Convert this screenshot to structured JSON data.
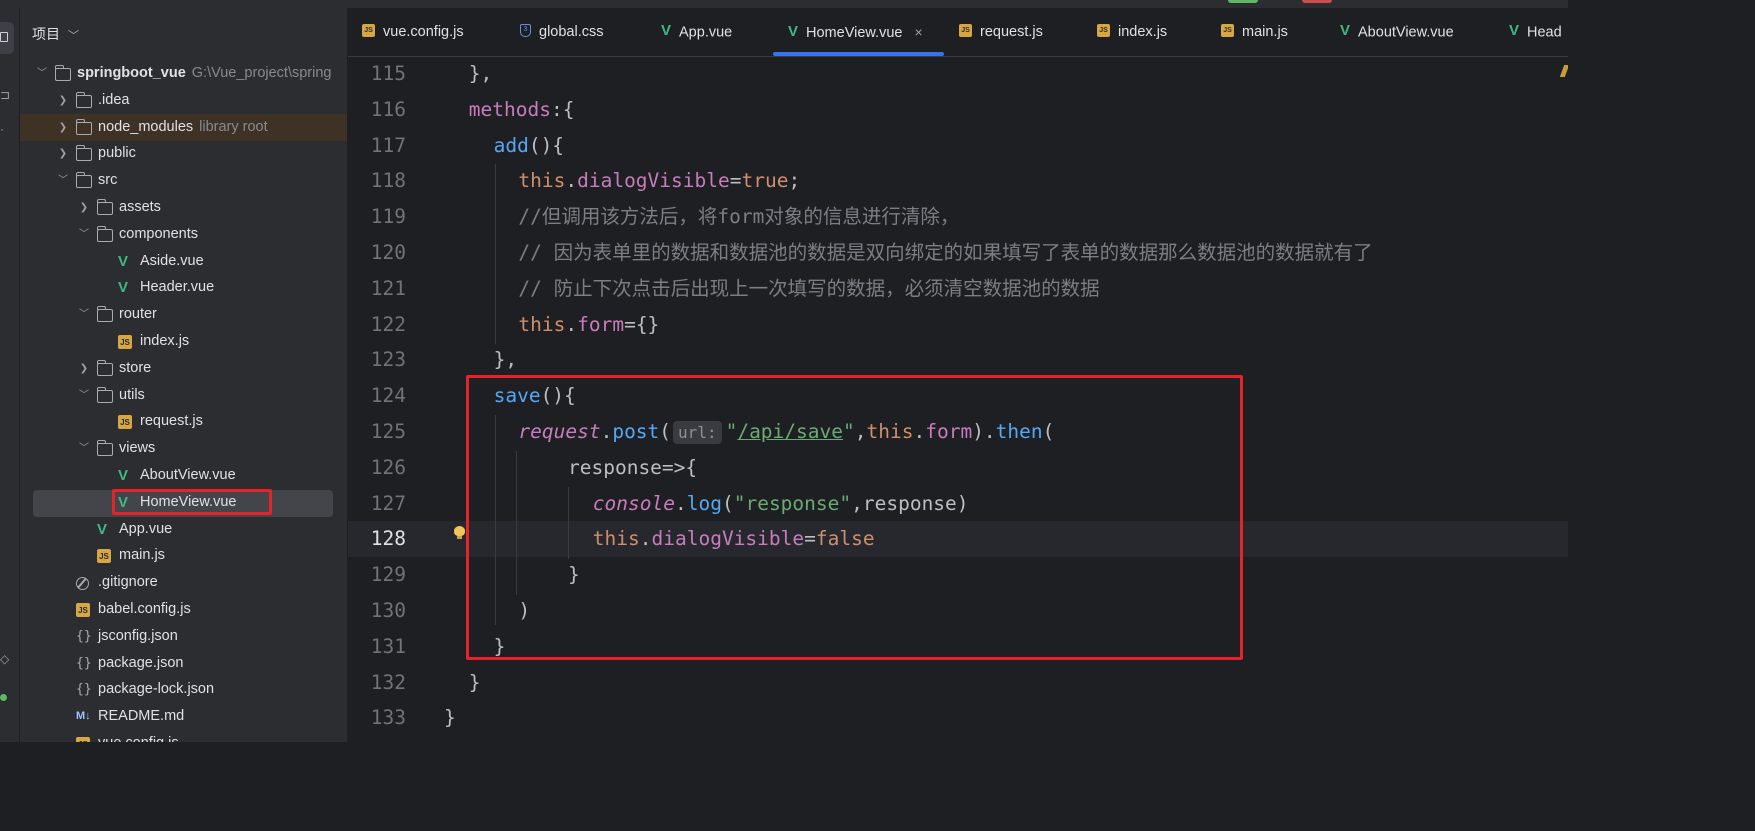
{
  "project_panel": {
    "title": "项目",
    "root": {
      "name": "springboot_vue",
      "path": "G:\\Vue_project\\spring"
    },
    "items": [
      {
        "label": "springboot_vue",
        "desc": "G:\\Vue_project\\spring",
        "kind": "folder",
        "expanded": true
      },
      {
        "label": ".idea",
        "kind": "folder"
      },
      {
        "label": "node_modules",
        "desc": "library root",
        "kind": "folder"
      },
      {
        "label": "public",
        "kind": "folder"
      },
      {
        "label": "src",
        "kind": "folder",
        "expanded": true
      },
      {
        "label": "assets",
        "kind": "folder"
      },
      {
        "label": "components",
        "kind": "folder",
        "expanded": true
      },
      {
        "label": "Aside.vue",
        "kind": "vue"
      },
      {
        "label": "Header.vue",
        "kind": "vue"
      },
      {
        "label": "router",
        "kind": "folder",
        "expanded": true
      },
      {
        "label": "index.js",
        "kind": "js"
      },
      {
        "label": "store",
        "kind": "folder"
      },
      {
        "label": "utils",
        "kind": "folder",
        "expanded": true
      },
      {
        "label": "request.js",
        "kind": "js"
      },
      {
        "label": "views",
        "kind": "folder",
        "expanded": true
      },
      {
        "label": "AboutView.vue",
        "kind": "vue"
      },
      {
        "label": "HomeView.vue",
        "kind": "vue",
        "selected": true
      },
      {
        "label": "App.vue",
        "kind": "vue"
      },
      {
        "label": "main.js",
        "kind": "js"
      },
      {
        "label": ".gitignore",
        "kind": "git"
      },
      {
        "label": "babel.config.js",
        "kind": "js"
      },
      {
        "label": "jsconfig.json",
        "kind": "json"
      },
      {
        "label": "package.json",
        "kind": "json"
      },
      {
        "label": "package-lock.json",
        "kind": "json"
      },
      {
        "label": "README.md",
        "kind": "md"
      },
      {
        "label": "vue.config.js",
        "kind": "js"
      }
    ]
  },
  "tabs": [
    {
      "label": "vue.config.js",
      "icon": "js-file-icon"
    },
    {
      "label": "global.css",
      "icon": "css-file-icon"
    },
    {
      "label": "App.vue",
      "icon": "vue-file-icon"
    },
    {
      "label": "HomeView.vue",
      "icon": "vue-file-icon",
      "active": true,
      "close": "×"
    },
    {
      "label": "request.js",
      "icon": "js-file-icon"
    },
    {
      "label": "index.js",
      "icon": "js-file-icon"
    },
    {
      "label": "main.js",
      "icon": "js-file-icon"
    },
    {
      "label": "AboutView.vue",
      "icon": "vue-file-icon"
    },
    {
      "label": "Head",
      "icon": "vue-file-icon"
    }
  ],
  "editor": {
    "current_line": "128",
    "lines": [
      {
        "n": "115",
        "indent": 1,
        "tokens": [
          {
            "t": "},",
            "c": ""
          }
        ]
      },
      {
        "n": "116",
        "indent": 1,
        "tokens": [
          {
            "t": "methods",
            "c": "p"
          },
          {
            "t": ":{",
            "c": ""
          }
        ]
      },
      {
        "n": "117",
        "indent": 2,
        "tokens": [
          {
            "t": "add",
            "c": "f"
          },
          {
            "t": "(){",
            "c": ""
          }
        ]
      },
      {
        "n": "118",
        "indent": 3,
        "tokens": [
          {
            "t": "this",
            "c": "k"
          },
          {
            "t": ".",
            "c": ""
          },
          {
            "t": "dialogVisible",
            "c": "p"
          },
          {
            "t": "=",
            "c": ""
          },
          {
            "t": "true",
            "c": "k"
          },
          {
            "t": ";",
            "c": ""
          }
        ]
      },
      {
        "n": "119",
        "indent": 3,
        "tokens": [
          {
            "t": "//但调用该方法后，将form对象的信息进行清除，",
            "c": "cm"
          }
        ]
      },
      {
        "n": "120",
        "indent": 3,
        "tokens": [
          {
            "t": "// 因为表单里的数据和数据池的数据是双向绑定的如果填写了表单的数据那么数据池的数据就有了",
            "c": "cm"
          }
        ]
      },
      {
        "n": "121",
        "indent": 3,
        "tokens": [
          {
            "t": "// 防止下次点击后出现上一次填写的数据，必须清空数据池的数据",
            "c": "cm"
          }
        ]
      },
      {
        "n": "122",
        "indent": 3,
        "tokens": [
          {
            "t": "this",
            "c": "k"
          },
          {
            "t": ".",
            "c": ""
          },
          {
            "t": "form",
            "c": "p"
          },
          {
            "t": "={}",
            "c": ""
          }
        ]
      },
      {
        "n": "123",
        "indent": 2,
        "tokens": [
          {
            "t": "},",
            "c": ""
          }
        ]
      },
      {
        "n": "124",
        "indent": 2,
        "tokens": [
          {
            "t": "save",
            "c": "f"
          },
          {
            "t": "(){",
            "c": ""
          }
        ]
      },
      {
        "n": "125",
        "indent": 3,
        "tokens": [
          {
            "t": "request",
            "c": "it"
          },
          {
            "t": ".",
            "c": ""
          },
          {
            "t": "post",
            "c": "f"
          },
          {
            "t": "(",
            "c": ""
          },
          {
            "t": "url:",
            "c": "hint"
          },
          {
            "t": "\"",
            "c": "s"
          },
          {
            "t": "/api/save",
            "c": "u"
          },
          {
            "t": "\"",
            "c": "s"
          },
          {
            "t": ",",
            "c": ""
          },
          {
            "t": "this",
            "c": "k"
          },
          {
            "t": ".",
            "c": ""
          },
          {
            "t": "form",
            "c": "p"
          },
          {
            "t": ").",
            "c": ""
          },
          {
            "t": "then",
            "c": "f"
          },
          {
            "t": "(",
            "c": ""
          }
        ]
      },
      {
        "n": "126",
        "indent": 5,
        "tokens": [
          {
            "t": "response=>{",
            "c": ""
          }
        ]
      },
      {
        "n": "127",
        "indent": 6,
        "tokens": [
          {
            "t": "console",
            "c": "it"
          },
          {
            "t": ".",
            "c": ""
          },
          {
            "t": "log",
            "c": "f"
          },
          {
            "t": "(",
            "c": ""
          },
          {
            "t": "\"response\"",
            "c": "s"
          },
          {
            "t": ",response)",
            "c": ""
          }
        ]
      },
      {
        "n": "128",
        "indent": 6,
        "tokens": [
          {
            "t": "this",
            "c": "k"
          },
          {
            "t": ".",
            "c": ""
          },
          {
            "t": "dialogVisible",
            "c": "p"
          },
          {
            "t": "=",
            "c": ""
          },
          {
            "t": "false",
            "c": "k"
          }
        ]
      },
      {
        "n": "129",
        "indent": 5,
        "tokens": [
          {
            "t": "}",
            "c": ""
          }
        ]
      },
      {
        "n": "130",
        "indent": 3,
        "tokens": [
          {
            "t": ")",
            "c": ""
          }
        ]
      },
      {
        "n": "131",
        "indent": 2,
        "tokens": [
          {
            "t": "}",
            "c": ""
          }
        ]
      },
      {
        "n": "132",
        "indent": 1,
        "tokens": [
          {
            "t": "}",
            "c": ""
          }
        ]
      },
      {
        "n": "133",
        "indent": 0,
        "tokens": [
          {
            "t": "}",
            "c": ""
          }
        ]
      }
    ]
  },
  "colors": {
    "accent": "#3574f0",
    "highlight_box": "#e5232b",
    "vue": "#41b883",
    "js": "#d6a743"
  }
}
